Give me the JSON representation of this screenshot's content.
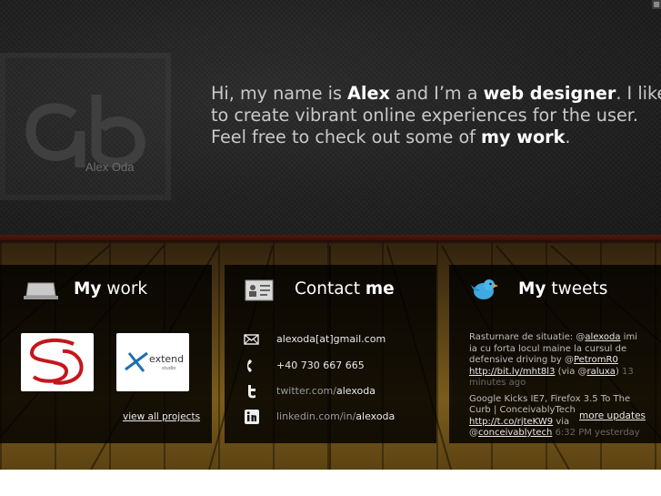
{
  "logo": {
    "mark": "ao",
    "text": "Alex Oda"
  },
  "intro": {
    "p1": "Hi, my name is ",
    "name": "Alex",
    "p2": " and I’m a ",
    "role": "web designer",
    "p3": ". I like",
    "line2": "to create vibrant online experiences for the user.",
    "p4": "Feel free to check out some of ",
    "work": "my work",
    "p5": "."
  },
  "panels": {
    "work": {
      "title_bold": "My",
      "title_rest": " work",
      "view_all": "view all projects"
    },
    "contact": {
      "title_rest": "Contact ",
      "title_bold": "me",
      "email": "alexoda[at]gmail.com",
      "phone": "+40 730 667 665",
      "twitter_prefix": "twitter.com/",
      "twitter_user": "alexoda",
      "linkedin_prefix": "linkedin.com/in/",
      "linkedin_user": "alexoda"
    },
    "tweets": {
      "title_bold": "My",
      "title_rest": " tweets",
      "tweet1": {
        "t1": "Rasturnare de situatie: @",
        "h1": "alexoda",
        "t2": " imi ia cu forta locul maine la cursul de defensive driving by @",
        "h2": "PetromR0",
        "link": "http://bit.ly/mht8l3",
        "t3": " (via @",
        "h3": "raluxa",
        "t4": ") ",
        "time": "13 minutes ago"
      },
      "tweet2": {
        "t1": "Google Kicks IE7, Firefox 3.5 To The Curb | ConceivablyTech ",
        "link": "http://t.co/rjteKW9",
        "t2": " via @",
        "h1": "conceivablytech",
        "time": " 6:32 PM yesterday"
      },
      "more": "more updates"
    }
  },
  "icons": {
    "work": "laptop-icon",
    "contact": "contact-card-icon",
    "tweets": "twitter-bird-icon",
    "email": "envelope-icon",
    "phone": "phone-icon",
    "twitter": "twitter-t-icon",
    "linkedin": "linkedin-icon"
  },
  "colors": {
    "accent_red": "#c4161c",
    "text_white": "#ffffff",
    "text_grey": "#c9c9c9"
  }
}
